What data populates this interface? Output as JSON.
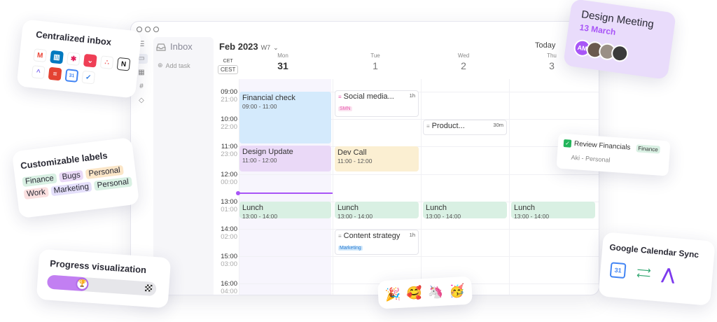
{
  "app": {
    "inbox_title": "Inbox",
    "add_task": "Add task",
    "month": "Feb 2023",
    "week": "W7",
    "today": "Today",
    "tz1": "CET",
    "tz2": "CEST"
  },
  "days": [
    {
      "name": "Mon",
      "date": "31"
    },
    {
      "name": "Tue",
      "date": "1"
    },
    {
      "name": "Wed",
      "date": "2"
    },
    {
      "name": "Thu",
      "date": "3"
    }
  ],
  "times": [
    {
      "t1": "09:00",
      "t2": "21:00"
    },
    {
      "t1": "10:00",
      "t2": "22:00"
    },
    {
      "t1": "11:00",
      "t2": "23:00"
    },
    {
      "t1": "12:00",
      "t2": "00:00"
    },
    {
      "t1": "13:00",
      "t2": "01:00"
    },
    {
      "t1": "14:00",
      "t2": "02:00"
    },
    {
      "t1": "15:00",
      "t2": "03:00"
    },
    {
      "t1": "16:00",
      "t2": "04:00"
    }
  ],
  "events": {
    "financial": {
      "title": "Financial check",
      "time": "09:00 - 11:00"
    },
    "design": {
      "title": "Design Update",
      "time": "11:00 - 12:00"
    },
    "social": {
      "title": "Social media...",
      "dur": "1h",
      "tag": "SMN"
    },
    "product": {
      "title": "Product...",
      "dur": "30m"
    },
    "devcall": {
      "title": "Dev Call",
      "time": "11:00 - 12:00"
    },
    "lunch": {
      "title": "Lunch",
      "time": "13:00 - 14:00"
    },
    "content": {
      "title": "Content strategy",
      "dur": "1h",
      "tag": "Marketing"
    }
  },
  "cards": {
    "inbox": {
      "title": "Centralized inbox"
    },
    "labels": {
      "title": "Customizable labels",
      "items": [
        "Finance",
        "Bugs",
        "Personal",
        "Work",
        "Marketing",
        "Personal"
      ]
    },
    "progress": {
      "title": "Progress visualization",
      "value": 0.38
    },
    "design": {
      "title": "Design Meeting",
      "date": "13 March",
      "avatar": "AM"
    },
    "review": {
      "title": "Review Financials",
      "tag": "Finance",
      "owner": "Aki - Personal"
    },
    "gcal": {
      "title": "Google Calendar Sync",
      "icon": "31"
    }
  },
  "colors": {
    "accent": "#a855f7",
    "blue": "#d4eafc",
    "purple": "#ead9f7",
    "yellow": "#fbefd2",
    "green": "#d9f0e3"
  }
}
